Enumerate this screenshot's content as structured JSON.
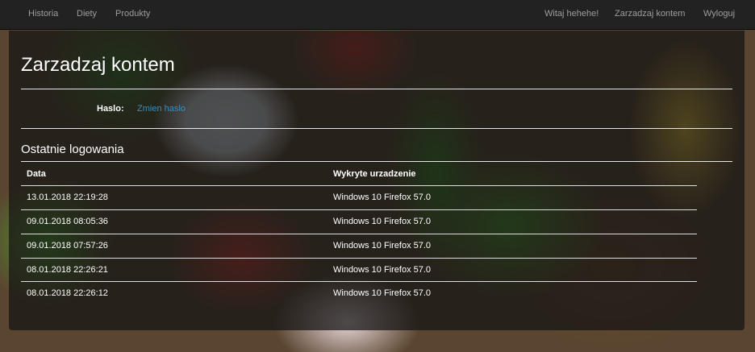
{
  "nav": {
    "left": [
      "Historia",
      "Diety",
      "Produkty"
    ],
    "greeting": "Witaj hehehe!",
    "manage": "Zarzadzaj kontem",
    "logout": "Wyloguj"
  },
  "page": {
    "title": "Zarzadzaj kontem",
    "password_label": "Haslo:",
    "password_link": "Zmien haslo",
    "section_title": "Ostatnie logowania"
  },
  "table": {
    "headers": [
      "Data",
      "Wykryte urzadzenie"
    ],
    "rows": [
      [
        "13.01.2018 22:19:28",
        "Windows 10 Firefox 57.0"
      ],
      [
        "09.01.2018 08:05:36",
        "Windows 10 Firefox 57.0"
      ],
      [
        "09.01.2018 07:57:26",
        "Windows 10 Firefox 57.0"
      ],
      [
        "08.01.2018 22:26:21",
        "Windows 10 Firefox 57.0"
      ],
      [
        "08.01.2018 22:26:12",
        "Windows 10 Firefox 57.0"
      ]
    ]
  },
  "colors": {
    "navbar": "#222222",
    "nav_text": "#9d9d9d",
    "link": "#3c8dbc"
  }
}
